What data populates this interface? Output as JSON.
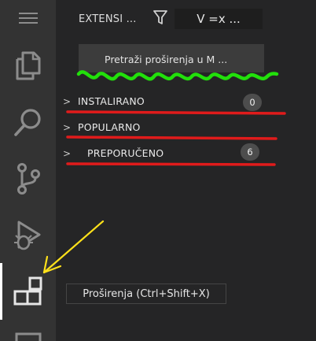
{
  "header": {
    "title": "EXTENSI ...",
    "views_label": "V =x ..."
  },
  "search": {
    "placeholder": "Pretraži proširenja u M ..."
  },
  "sections": [
    {
      "chevron": ">",
      "label": "INSTALIRANO",
      "count": "0"
    },
    {
      "chevron": ">",
      "label": "POPULARNO",
      "count": ""
    },
    {
      "chevron": ">",
      "label": "PREPORUČENO",
      "count": "6"
    }
  ],
  "tooltip": {
    "text": "Proširenja (Ctrl+Shift+X)"
  },
  "activity_bar": {
    "icons": [
      "menu-icon",
      "explorer-icon",
      "search-icon",
      "source-control-icon",
      "run-debug-icon",
      "extensions-icon",
      "remote-icon"
    ]
  },
  "colors": {
    "activity_bar": "#333333",
    "sidebar": "#252526",
    "annotation_red": "#e01b1b",
    "annotation_green": "#22e00b",
    "annotation_yellow": "#ffe11a"
  }
}
